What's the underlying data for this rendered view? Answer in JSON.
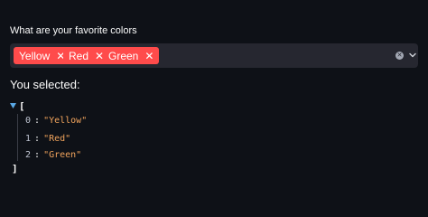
{
  "question_label": "What are your favorite colors",
  "multiselect": {
    "tags": [
      {
        "label": "Yellow"
      },
      {
        "label": "Red"
      },
      {
        "label": "Green"
      }
    ],
    "tag_color": "#ff4b4b",
    "clear_icon": "clear-circle-icon",
    "dropdown_icon": "chevron-down-icon"
  },
  "selected_label": "You selected:",
  "json_view": {
    "open_bracket": "[",
    "close_bracket": "]",
    "items": [
      {
        "index": "0",
        "value": "\"Yellow\""
      },
      {
        "index": "1",
        "value": "\"Red\""
      },
      {
        "index": "2",
        "value": "\"Green\""
      }
    ]
  }
}
